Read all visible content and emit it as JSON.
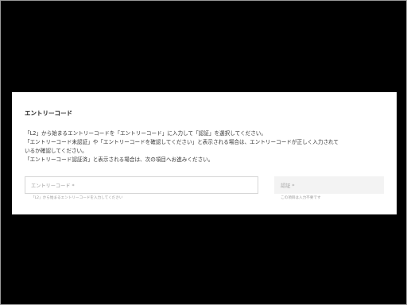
{
  "section": {
    "title": "エントリーコード",
    "description": [
      "「L2」から始まるエントリーコードを「エントリーコード」に入力して「認証」を選択してください。",
      "「エントリーコード未認証」や「エントリーコードを確認してください」と表示される場合は、エントリーコードが正しく入力されて",
      "いるか確認してください。",
      "「エントリーコード認証済」と表示される場合は、次の項目へお進みください。"
    ]
  },
  "entry_code": {
    "placeholder": "エントリーコード *",
    "hint": "「L2」から始まるエントリーコードを入力してください"
  },
  "auth": {
    "placeholder": "認証 *",
    "hint": "この項目は入力不要です"
  },
  "colors": {
    "background": "#000000",
    "card": "#ffffff",
    "auth_field_bg": "#f3f3f3",
    "border": "#d6d6d6"
  }
}
